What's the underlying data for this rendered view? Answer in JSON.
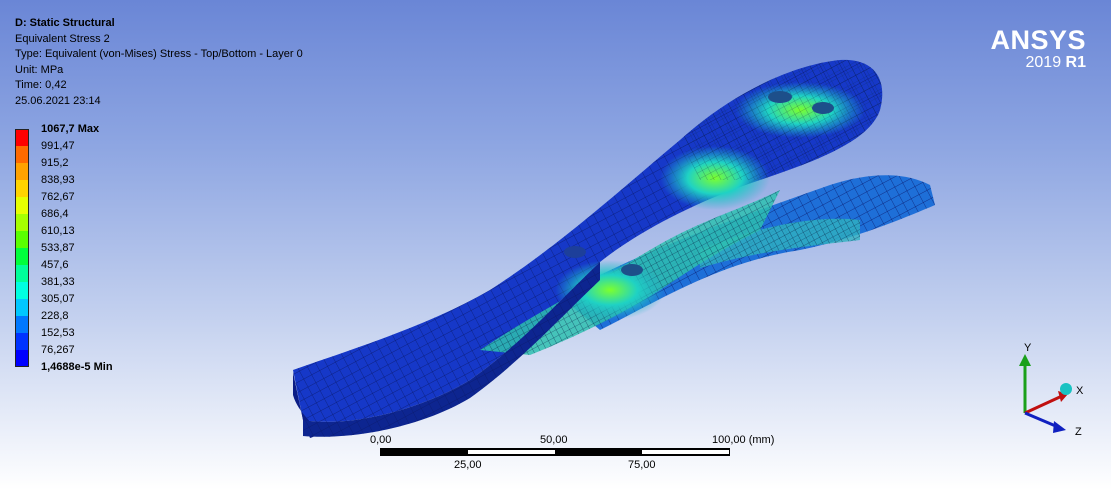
{
  "info": {
    "title": "D: Static Structural",
    "result": "Equivalent Stress 2",
    "type": "Type: Equivalent (von-Mises) Stress - Top/Bottom - Layer 0",
    "unit": "Unit: MPa",
    "time": "Time: 0,42",
    "date": "25.06.2021 23:14"
  },
  "legend": {
    "max_label": "1067,7 Max",
    "min_label": "1,4688e-5 Min",
    "values": [
      "991,47",
      "915,2",
      "838,93",
      "762,67",
      "686,4",
      "610,13",
      "533,87",
      "457,6",
      "381,33",
      "305,07",
      "228,8",
      "152,53",
      "76,267"
    ],
    "colors": [
      "#ff0000",
      "#ff6a00",
      "#ffa200",
      "#ffd400",
      "#e7ff00",
      "#a6ff00",
      "#5aff00",
      "#00ff3c",
      "#00ff9a",
      "#00ffe1",
      "#00c8ff",
      "#0078ff",
      "#0033ff",
      "#0000ff"
    ]
  },
  "logo": {
    "brand": "ANSYS",
    "version": "2019",
    "release": "R1"
  },
  "scale": {
    "top_ticks": [
      "0,00",
      "50,00",
      "100,00 (mm)"
    ],
    "bottom_ticks": [
      "25,00",
      "75,00"
    ]
  },
  "triad": {
    "y": "Y",
    "x": "X",
    "z": "Z"
  }
}
